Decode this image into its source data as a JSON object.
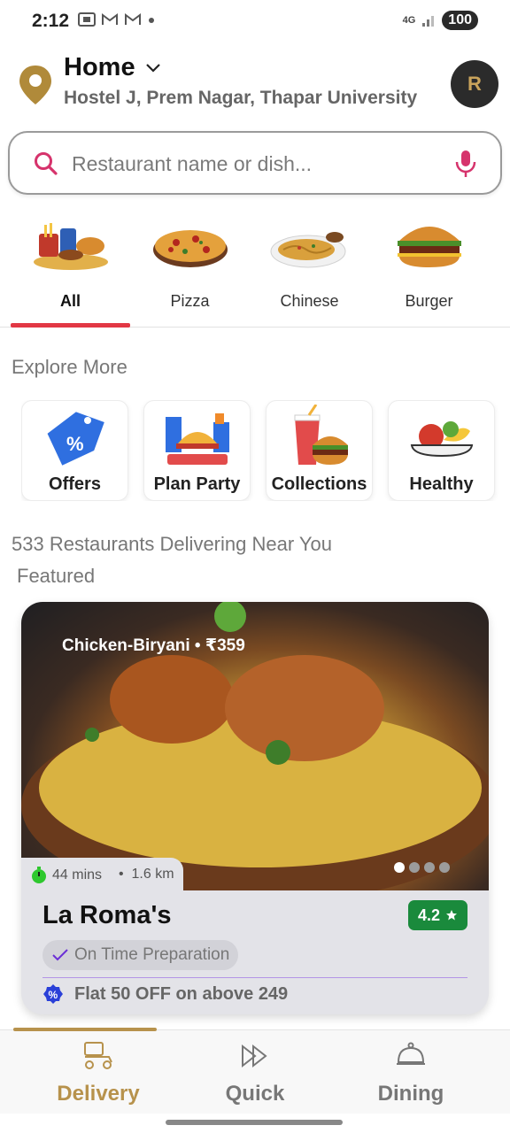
{
  "status_bar": {
    "time": "2:12",
    "notif_icons": [
      "screenshot-icon",
      "gmail-icon",
      "gmail-icon",
      "dot"
    ],
    "network": "4G",
    "battery": "100"
  },
  "location": {
    "title": "Home",
    "address": "Hostel J, Prem Nagar, Thapar University",
    "avatar_initial": "R"
  },
  "search": {
    "placeholder": "Restaurant name or dish..."
  },
  "categories": [
    {
      "label": "All",
      "active": true
    },
    {
      "label": "Pizza",
      "active": false
    },
    {
      "label": "Chinese",
      "active": false
    },
    {
      "label": "Burger",
      "active": false
    }
  ],
  "explore": {
    "title": "Explore More",
    "items": [
      {
        "label": "Offers"
      },
      {
        "label": "Plan Party"
      },
      {
        "label": "Collections"
      },
      {
        "label": "Healthy"
      }
    ]
  },
  "restaurants": {
    "count_text": "533 Restaurants Delivering Near You",
    "featured_label": "Featured"
  },
  "featured_card": {
    "dish_tag": "Chicken-Biryani  • ₹359",
    "time": "44 mins",
    "distance": "1.6 km",
    "name": "La Roma's",
    "rating": "4.2",
    "badge": "On Time Preparation",
    "offer": "Flat 50 OFF on above 249",
    "carousel_dots": 4,
    "carousel_active": 0
  },
  "bottom_nav": [
    {
      "label": "Delivery",
      "active": true
    },
    {
      "label": "Quick",
      "active": false
    },
    {
      "label": "Dining",
      "active": false
    }
  ],
  "colors": {
    "accent_red": "#e23744",
    "brand_gold": "#b7924c",
    "rating_green": "#1a8a3c",
    "search_pink": "#d6336c"
  }
}
